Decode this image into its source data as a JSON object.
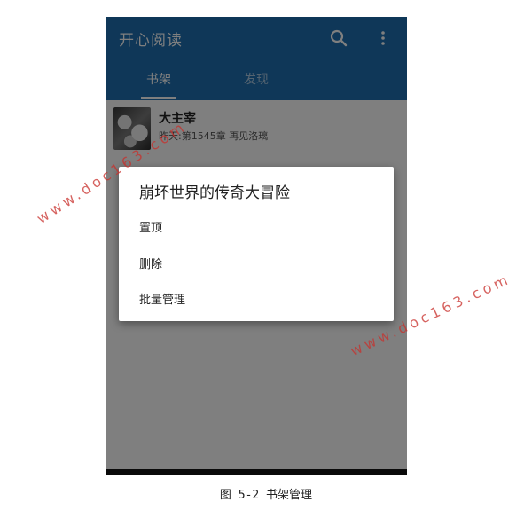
{
  "app": {
    "title": "开心阅读",
    "icons": [
      "search-icon",
      "more-vert-icon"
    ],
    "primary_color": "#1e6fb0"
  },
  "tabs": [
    {
      "label": "书架",
      "selected": true
    },
    {
      "label": "发现",
      "selected": false
    }
  ],
  "bookshelf": {
    "items": [
      {
        "title": "大主宰",
        "update": "昨天:第1545章 再见洛璃"
      }
    ]
  },
  "dialog": {
    "title": "崩坏世界的传奇大冒险",
    "options": [
      "置顶",
      "删除",
      "批量管理"
    ]
  },
  "caption": "图 5-2 书架管理",
  "watermark": "www.doc163.com"
}
